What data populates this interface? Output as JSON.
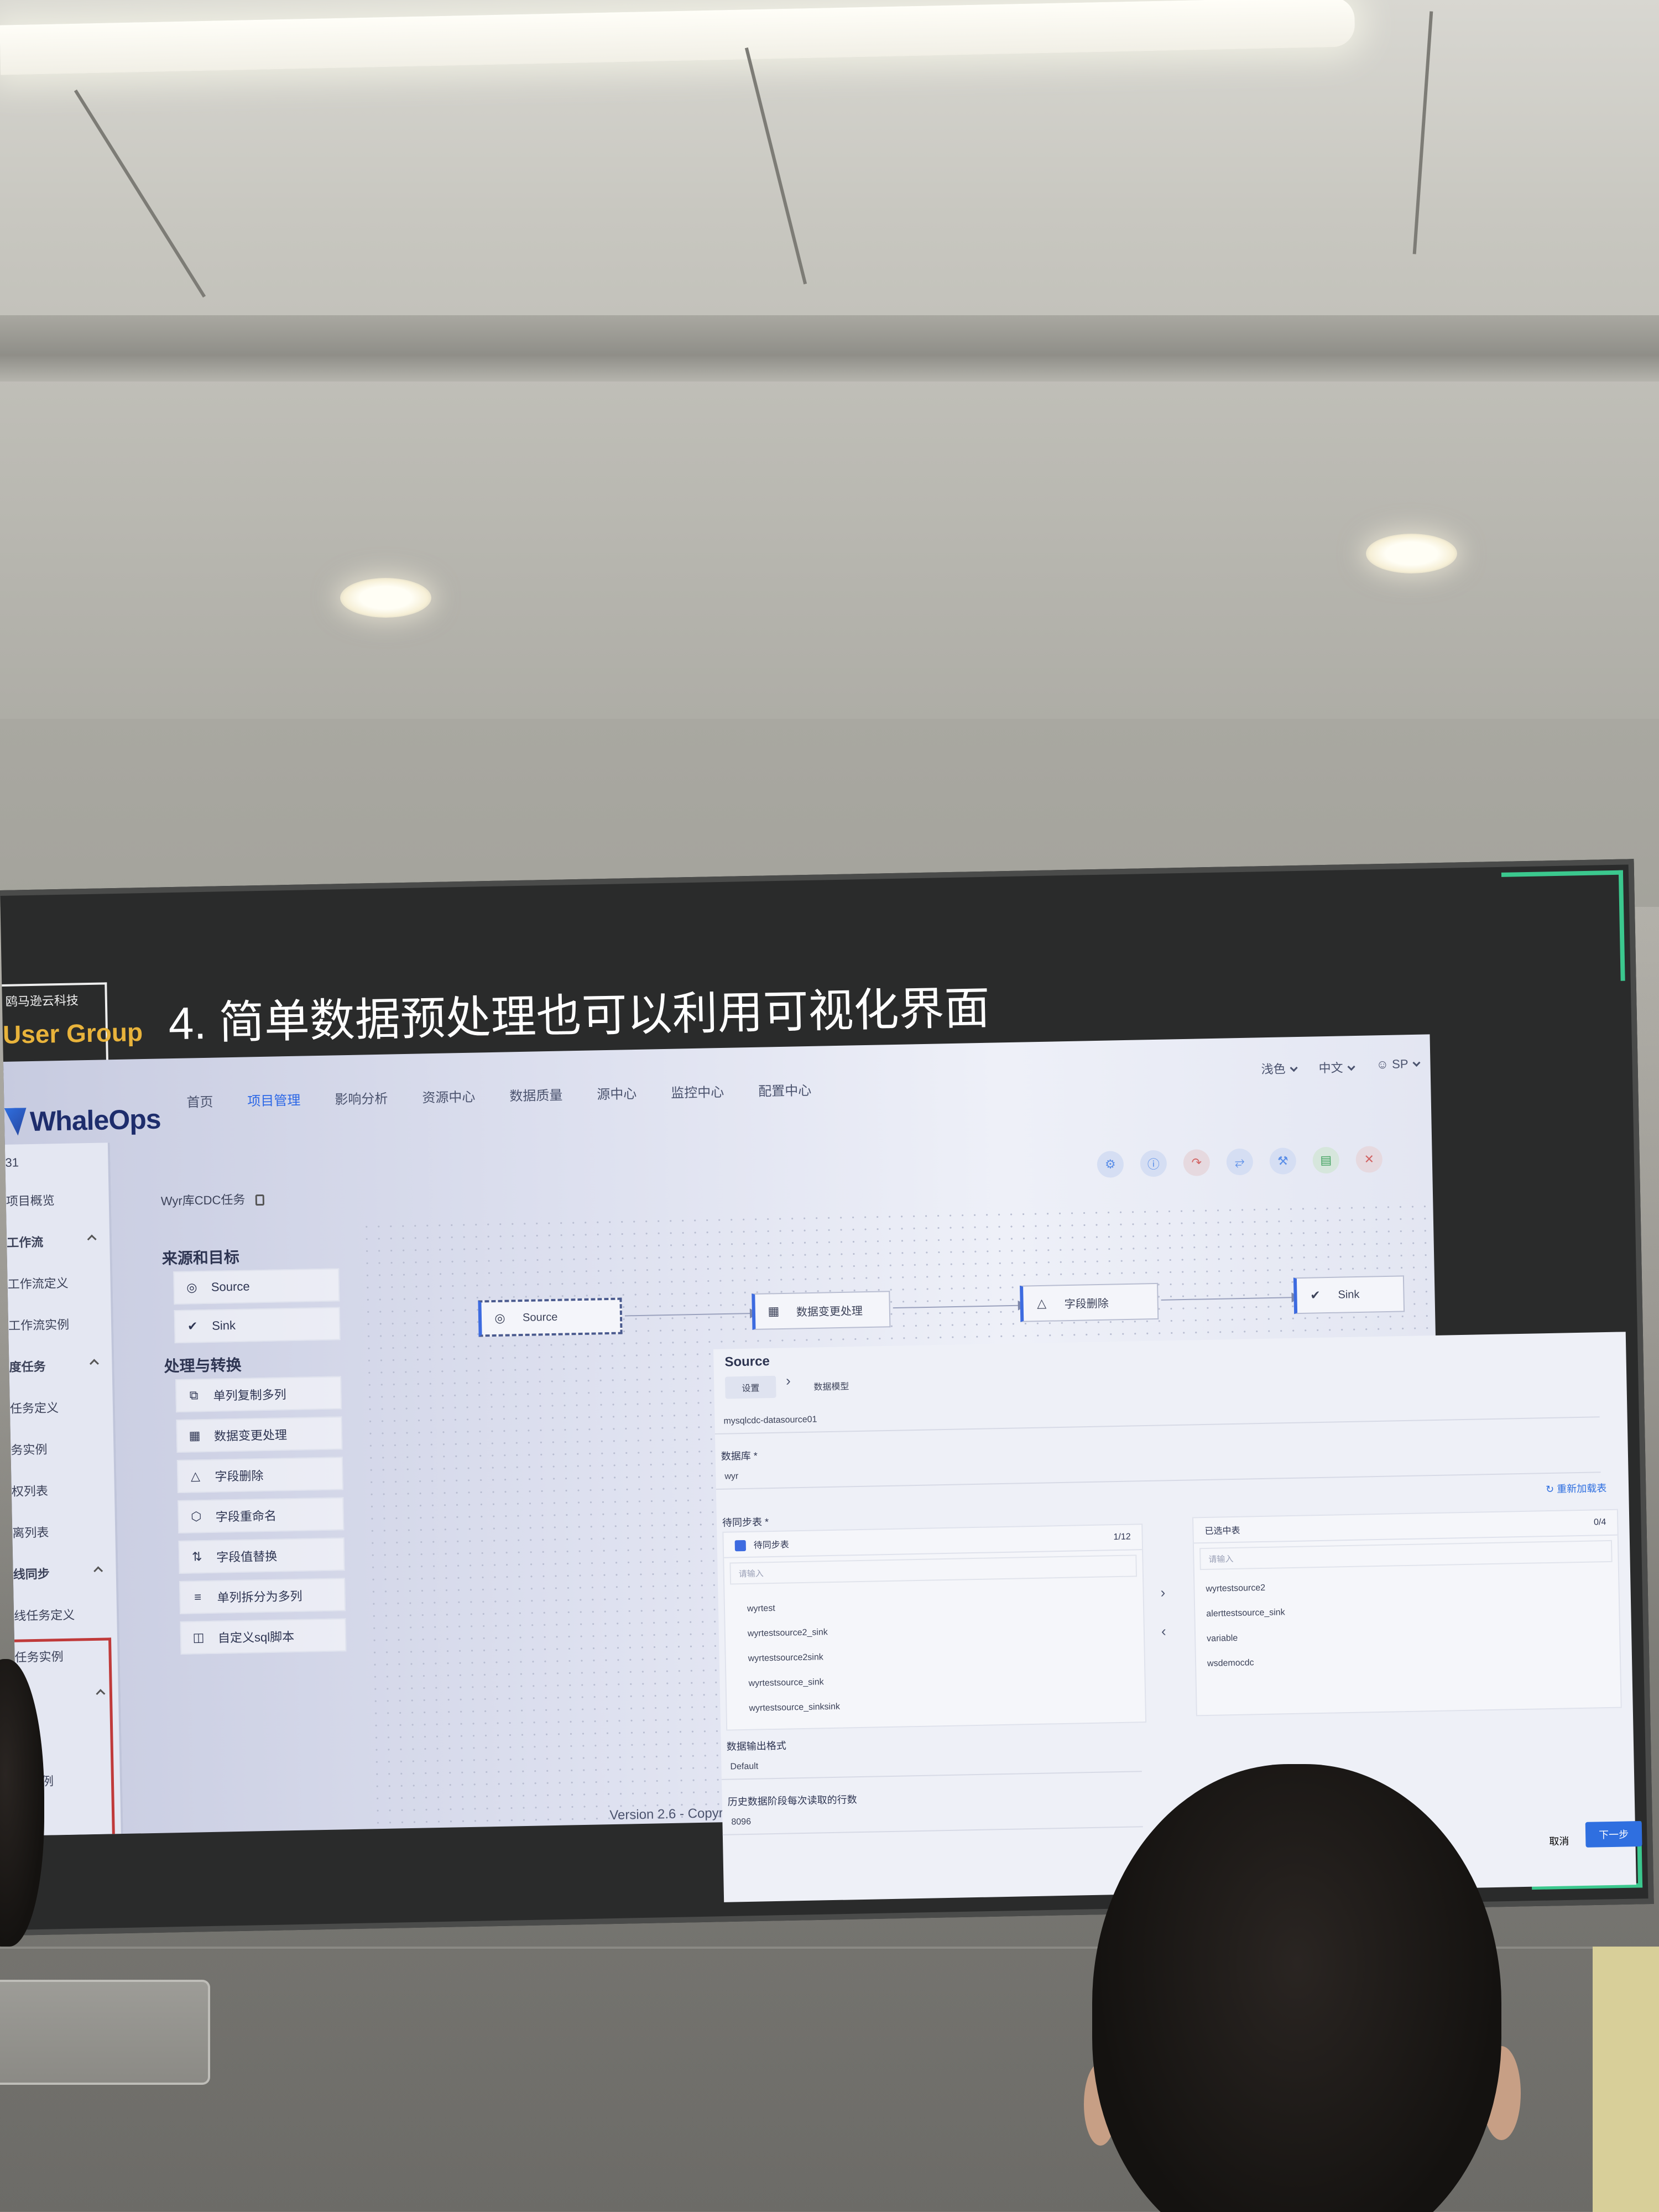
{
  "slide": {
    "company": "鸥马逊云科技",
    "group": "User Group",
    "title": "4. 简单数据预处理也可以利用可视化界面"
  },
  "app": {
    "logo": "WhaleOps",
    "nav": [
      "首页",
      "项目管理",
      "影响分析",
      "资源中心",
      "数据质量",
      "源中心",
      "监控中心",
      "配置中心"
    ],
    "nav_active": "项目管理",
    "header_right": {
      "theme": "浅色",
      "language": "中文",
      "user": "SP"
    },
    "sidebar": [
      {
        "label": "31",
        "type": "item"
      },
      {
        "label": "项目概览",
        "type": "item"
      },
      {
        "label": "工作流",
        "type": "group"
      },
      {
        "label": "工作流定义",
        "type": "item"
      },
      {
        "label": "工作流实例",
        "type": "item"
      },
      {
        "label": "度任务",
        "type": "group"
      },
      {
        "label": "任务定义",
        "type": "item"
      },
      {
        "label": "务实例",
        "type": "item"
      },
      {
        "label": "权列表",
        "type": "item"
      },
      {
        "label": "离列表",
        "type": "item"
      },
      {
        "label": "线同步",
        "type": "group"
      },
      {
        "label": "线任务定义",
        "type": "item"
      },
      {
        "label": "任务实例",
        "type": "item"
      },
      {
        "label": "",
        "type": "group"
      },
      {
        "label": "定义",
        "type": "item"
      },
      {
        "label": "务实例",
        "type": "item"
      }
    ],
    "task_title": "Wyr库CDC任务",
    "components": {
      "section_source_sink": "来源和目标",
      "source": "Source",
      "sink": "Sink",
      "section_transform": "处理与转换",
      "transforms": [
        "单列复制多列",
        "数据变更处理",
        "字段删除",
        "字段重命名",
        "字段值替换",
        "单列拆分为多列",
        "自定义sql脚本"
      ]
    },
    "canvas_nodes": [
      "Source",
      "数据变更处理",
      "字段删除",
      "Sink"
    ],
    "version": "Version 2.6 - Copyric"
  },
  "drawer": {
    "title": "Source",
    "tabs": [
      "设置",
      "数据模型"
    ],
    "datasource": "mysqlcdc-datasource01",
    "db_label": "数据库 *",
    "db_value": "wyr",
    "reload": "重新加载表",
    "tables_label": "待同步表 *",
    "left_list": {
      "header": "待同步表",
      "count": "1/12",
      "search_placeholder": "请输入",
      "items": [
        "wyrtest",
        "wyrtestsource2_sink",
        "wyrtestsource2sink",
        "wyrtestsource_sink",
        "wyrtestsource_sinksink"
      ]
    },
    "right_list": {
      "header": "已选中表",
      "count": "0/4",
      "search_placeholder": "请输入",
      "items": [
        "wyrtestsource2",
        "alerttestsource_sink",
        "variable",
        "wsdemocdc"
      ]
    },
    "output_label": "数据输出格式",
    "output_value": "Default",
    "history_label": "历史数据阶段每次读取的行数",
    "history_value": "8096",
    "cancel": "取消",
    "next": "下一步"
  }
}
